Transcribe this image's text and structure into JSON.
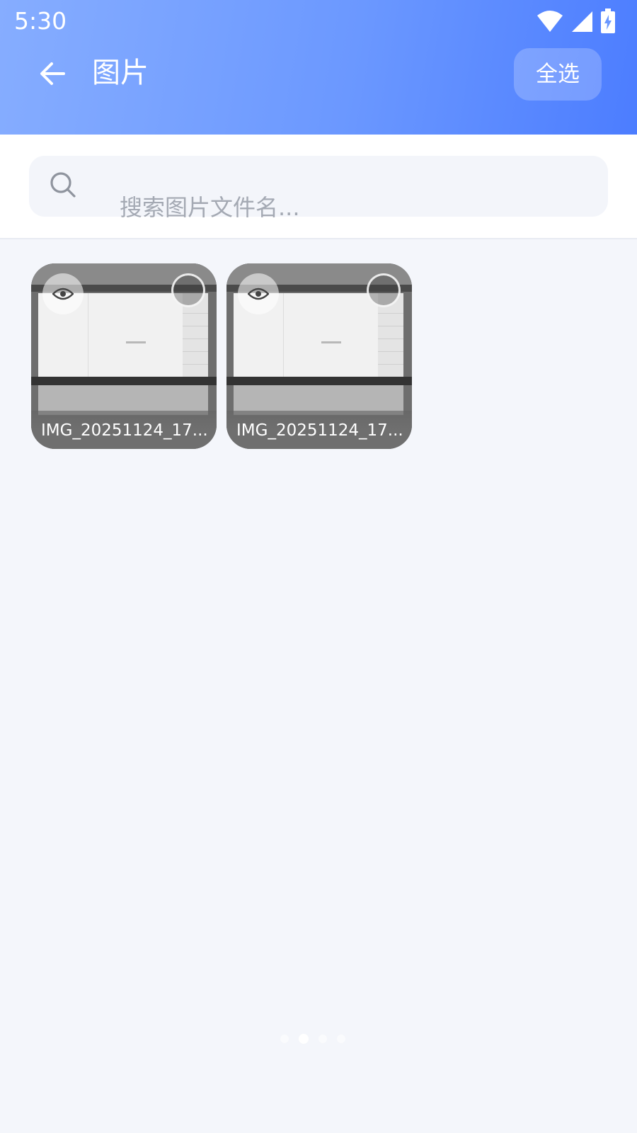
{
  "status_bar": {
    "time": "5:30"
  },
  "header": {
    "title": "图片",
    "select_all_label": "全选"
  },
  "search": {
    "placeholder": "搜索图片文件名..."
  },
  "images": [
    {
      "name": "IMG_20251124_17..."
    },
    {
      "name": "IMG_20251124_17..."
    }
  ],
  "colors": {
    "header_start": "#86ADFF",
    "header_end": "#4C7DFF",
    "background": "#F4F6FB"
  },
  "icons": {
    "back": "arrow-left-icon",
    "search": "search-icon",
    "preview": "eye-icon",
    "wifi": "wifi-icon",
    "signal": "cell-signal-icon",
    "battery": "battery-charging-icon"
  }
}
